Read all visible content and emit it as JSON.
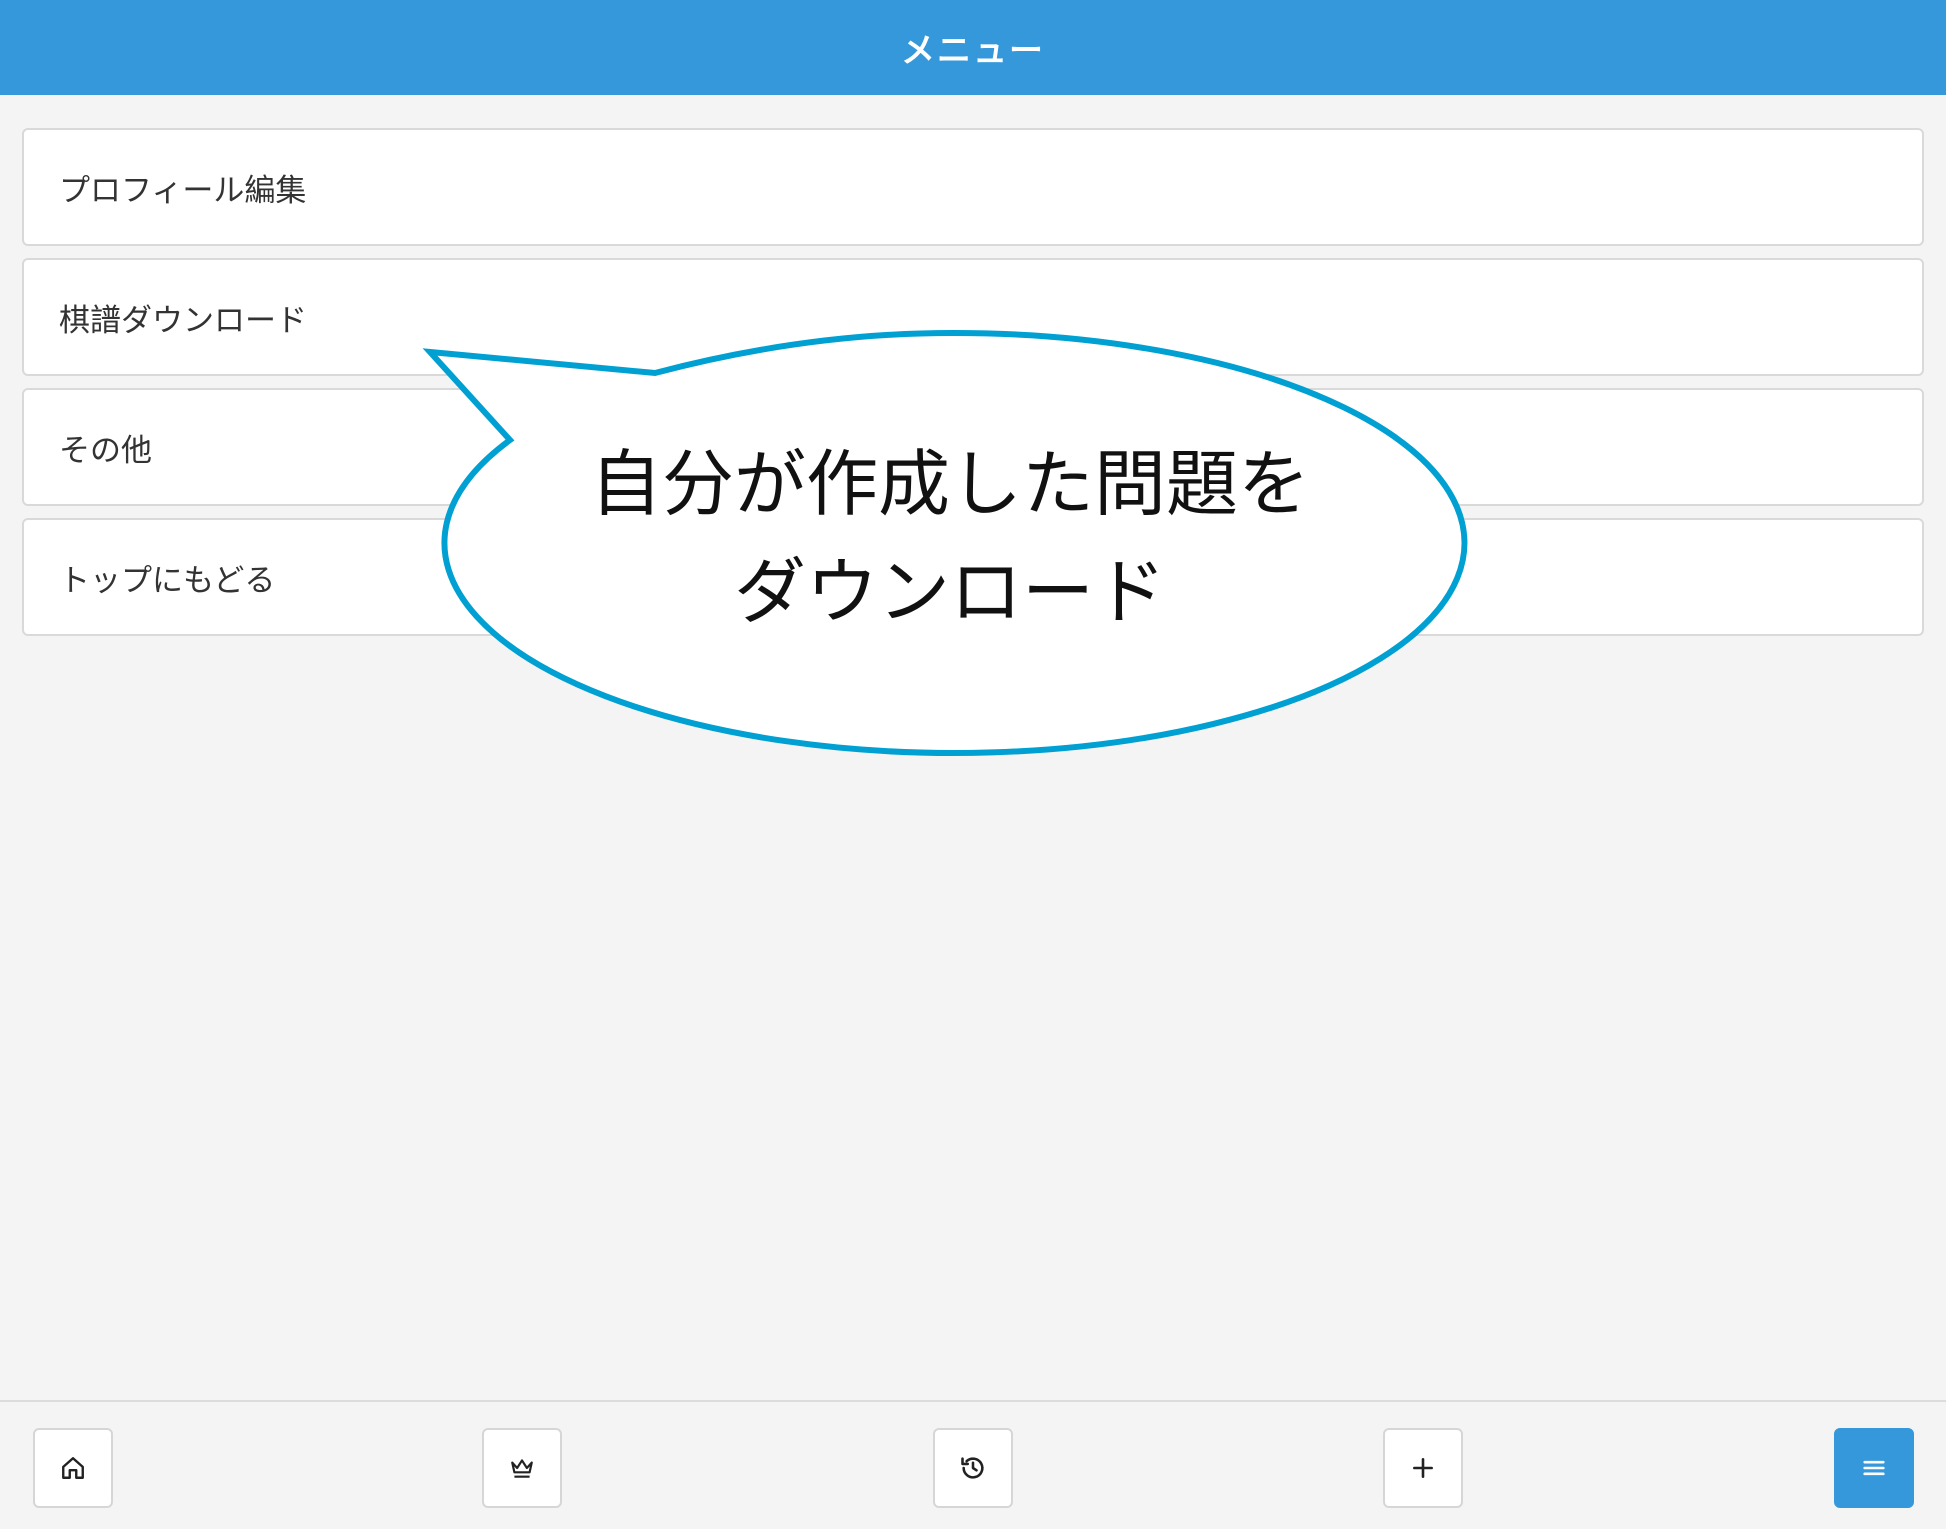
{
  "header": {
    "title": "メニュー"
  },
  "menu": {
    "items": [
      {
        "label": "プロフィール編集"
      },
      {
        "label": "棋譜ダウンロード"
      },
      {
        "label": "その他"
      },
      {
        "label": "トップにもどる"
      }
    ]
  },
  "callout": {
    "line1": "自分が作成した問題を",
    "line2": "ダウンロード",
    "border_color": "#00a0d2"
  },
  "tabbar": {
    "buttons": [
      {
        "icon": "home-icon"
      },
      {
        "icon": "crown-icon"
      },
      {
        "icon": "history-icon"
      },
      {
        "icon": "plus-icon"
      },
      {
        "icon": "menu-icon"
      }
    ],
    "active_color": "#3498db"
  },
  "colors": {
    "header_bg": "#3498db",
    "page_bg": "#f4f4f4"
  }
}
